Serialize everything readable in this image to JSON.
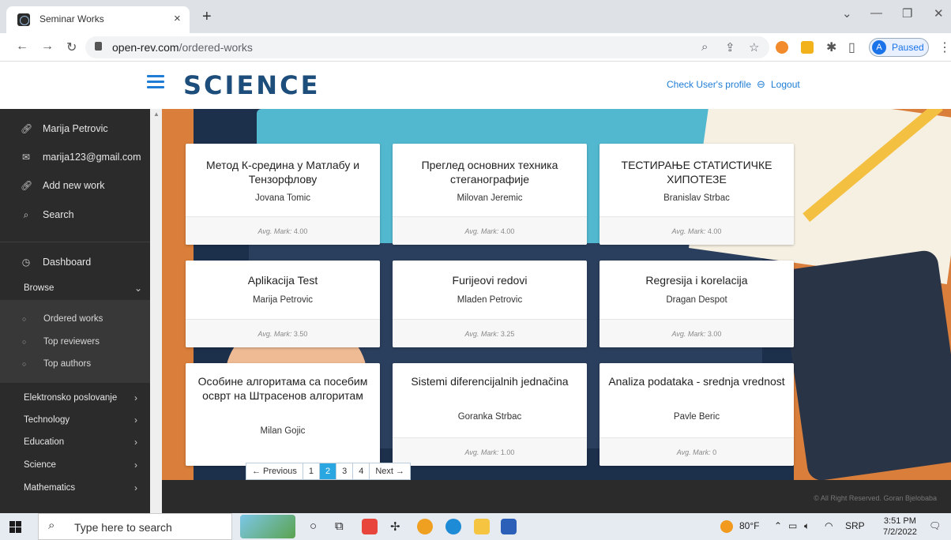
{
  "browser": {
    "tab_title": "Seminar Works",
    "tab_close": "×",
    "new_tab": "+",
    "url_host": "open-rev.com",
    "url_path": "/ordered-works",
    "profile_initial": "A",
    "profile_status": "Paused"
  },
  "header": {
    "logo_text": "SCIENCE",
    "profile_link": "Check User's profile",
    "logout_link": "Logout"
  },
  "sidebar": {
    "user_name": "Marija Petrovic",
    "user_email": "marija123@gmail.com",
    "add_new_work": "Add new work",
    "search": "Search",
    "dashboard": "Dashboard",
    "browse": "Browse",
    "browse_items": [
      "Ordered works",
      "Top reviewers",
      "Top authors"
    ],
    "categories": [
      "Elektronsko poslovanje",
      "Technology",
      "Education",
      "Science",
      "Mathematics"
    ]
  },
  "works": [
    {
      "title": "Метод К-средина у Матлабу и Тензорфлову",
      "author": "Jovana Tomic",
      "mark_label": "Avg. Mark:",
      "mark": "4.00"
    },
    {
      "title": "Преглед основних техника стеганографије",
      "author": "Milovan Jeremic",
      "mark_label": "Avg. Mark:",
      "mark": "4.00"
    },
    {
      "title": "ТЕСТИРАЊЕ СТАТИСТИЧКЕ ХИПОТЕЗЕ",
      "author": "Branislav Strbac",
      "mark_label": "Avg. Mark:",
      "mark": "4.00"
    },
    {
      "title": "Aplikacija Test",
      "author": "Marija Petrovic",
      "mark_label": "Avg. Mark:",
      "mark": "3.50"
    },
    {
      "title": "Furijeovi redovi",
      "author": "Mladen Petrovic",
      "mark_label": "Avg. Mark:",
      "mark": "3.25"
    },
    {
      "title": "Regresija i korelacija",
      "author": "Dragan Despot",
      "mark_label": "Avg. Mark:",
      "mark": "3.00"
    },
    {
      "title": "Особине алгоритама са посебим осврт на Штрасенов алгоритам",
      "author": "Milan Gojic",
      "mark_label": "",
      "mark": ""
    },
    {
      "title": "Sistemi diferencijalnih jednačina",
      "author": "Goranka Strbac",
      "mark_label": "Avg. Mark:",
      "mark": "1.00"
    },
    {
      "title": "Analiza podataka - srednja vrednost",
      "author": "Pavle Beric",
      "mark_label": "Avg. Mark:",
      "mark": "0"
    }
  ],
  "pagination": {
    "previous": "← Previous",
    "pages": [
      "1",
      "2",
      "3",
      "4"
    ],
    "current": "2",
    "next": "Next →"
  },
  "footer": {
    "text": "© All Right Reserved. Goran Bjelobaba"
  },
  "taskbar": {
    "search_placeholder": "Type here to search",
    "weather": "80°F",
    "language": "SRP",
    "time": "3:51 PM",
    "date": "7/2/2022"
  }
}
